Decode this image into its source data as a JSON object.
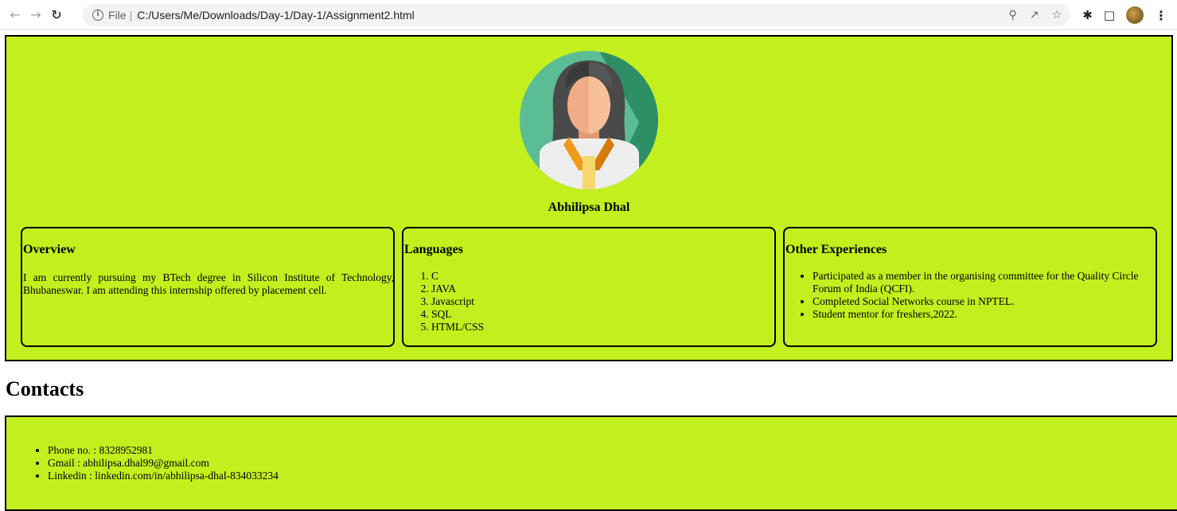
{
  "browser": {
    "file_label": "File",
    "separator": "|",
    "url": "C:/Users/Me/Downloads/Day-1/Day-1/Assignment2.html",
    "icons": [
      "back-arrow-icon",
      "forward-arrow-icon",
      "reload-icon",
      "info-icon",
      "zoom-icon",
      "share-icon",
      "bookmark-star-icon",
      "extensions-puzzle-icon",
      "side-panel-icon",
      "profile-avatar",
      "more-menu-icon"
    ]
  },
  "profile": {
    "name": "Abhilipsa Dhal"
  },
  "overview": {
    "heading": "Overview",
    "text": "I am currently pursuing my BTech degree in Silicon Institute of Technology, Bhubaneswar. I am attending this internship offered by placement cell."
  },
  "languages": {
    "heading": "Languages",
    "items": [
      "C",
      "JAVA",
      "Javascript",
      "SQL",
      "HTML/CSS"
    ]
  },
  "experiences": {
    "heading": "Other Experiences",
    "items": [
      "Participated as a member in the organising committee for the Quality Circle Forum of India (QCFI).",
      "Completed Social Networks course in NPTEL.",
      "Student mentor for freshers,2022."
    ]
  },
  "contacts": {
    "heading": "Contacts",
    "items": [
      "Phone no. : 8328952981",
      "Gmail : abhilipsa.dhal99@gmail.com",
      "Linkedin : linkedin.com/in/abhilipsa-dhal-834033234"
    ]
  },
  "colors": {
    "page_accent": "#c3ef1e",
    "border": "#000000"
  }
}
